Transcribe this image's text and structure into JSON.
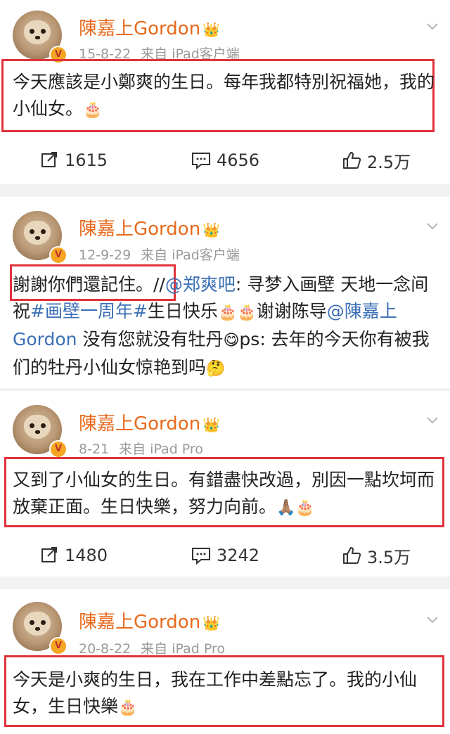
{
  "posts": [
    {
      "username": "陳嘉上Gordon",
      "date": "15-8-22",
      "source": "来自 iPad客户端",
      "text_parts": [
        "今天應該是小鄭爽的生日。每年我都特別祝福她，我的小仙女。",
        "🎂"
      ],
      "actions": {
        "repost": "1615",
        "comment": "4656",
        "like": "2.5万"
      }
    },
    {
      "username": "陳嘉上Gordon",
      "date": "12-9-29",
      "source": "来自 iPad客户端",
      "text_parts": {
        "p1": "謝謝你們還記住。//",
        "mention1": "@郑爽吧",
        "p2": ": 寻梦入画壁 天地一念间 祝",
        "hashtag": "#画壁一周年#",
        "p3": "生日快乐",
        "e1": "🎂🎂",
        "p4": "谢谢陈导",
        "mention2": "@陳嘉上Gordon",
        "p5": " 没有您就没有牡丹",
        "e2": "😋",
        "p6": "ps: 去年的今天你有被我们的牡丹小仙女惊艳到吗",
        "e3": "🤔"
      }
    },
    {
      "username": "陳嘉上Gordon",
      "date": "8-21",
      "source": "来自 iPad Pro",
      "text_parts": [
        "又到了小仙女的生日。有錯盡快改過，別因一點坎坷而放棄正面。生日快樂，努力向前。",
        "🙏🏽",
        "🎂"
      ],
      "actions": {
        "repost": "1480",
        "comment": "3242",
        "like": "3.5万"
      }
    },
    {
      "username": "陳嘉上Gordon",
      "date": "20-8-22",
      "source": "来自 iPad Pro",
      "text_parts": [
        "今天是小爽的生日，我在工作中差點忘了。我的小仙女，生日快樂",
        "🎂"
      ]
    }
  ],
  "icons": {
    "verified": "V",
    "crown": "👑"
  },
  "colors": {
    "username": "#e86a1c",
    "link": "#3b6fb6",
    "highlight_box": "#e1323a",
    "meta": "#9a9a9a"
  }
}
